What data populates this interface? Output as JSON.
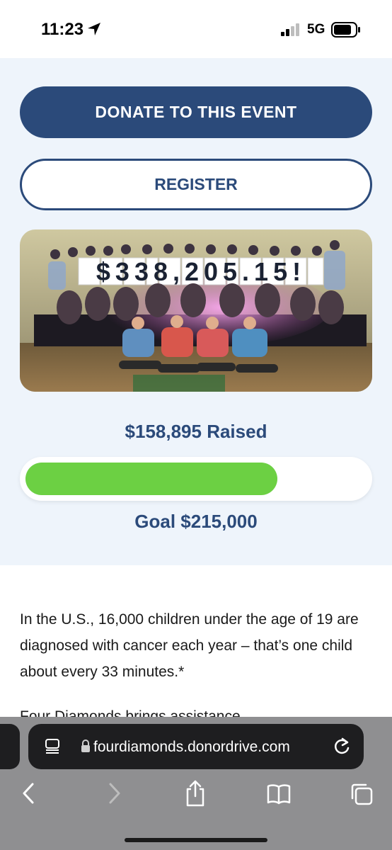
{
  "status_bar": {
    "time": "11:23",
    "network": "5G"
  },
  "event": {
    "donate_label": "DONATE TO THIS EVENT",
    "register_label": "REGISTER",
    "photo_sign_text": "$338,205.15!",
    "raised_text": "$158,895 Raised",
    "goal_text": "Goal $215,000",
    "progress_fraction": 0.739
  },
  "content": {
    "paragraph": "In the U.S., 16,000 children under the age of 19 are diagnosed with cancer each year – that’s one child about every 33 minutes.*",
    "next_line_partial": "Four Diamonds brings assistance"
  },
  "browser": {
    "url": "fourdiamonds.donordrive.com"
  },
  "icons": [
    "location-arrow-icon",
    "signal-icon",
    "battery-icon",
    "reader-icon",
    "lock-icon",
    "reload-icon",
    "back-icon",
    "forward-icon",
    "share-icon",
    "bookmarks-icon",
    "tabs-icon"
  ],
  "colors": {
    "primary": "#2b4a7a",
    "progress": "#6cd043",
    "panel_bg": "#eef4fb"
  }
}
